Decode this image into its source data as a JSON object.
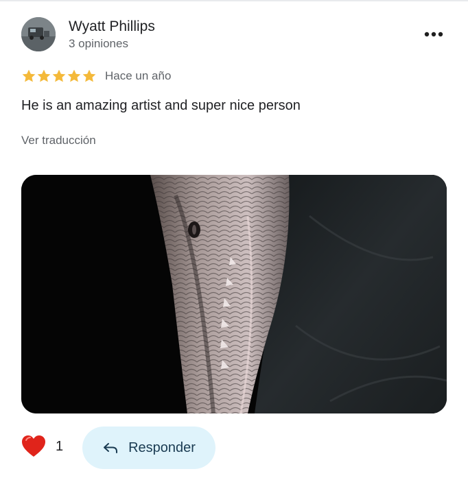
{
  "review": {
    "author": "Wyatt Phillips",
    "review_count": "3 opiniones",
    "rating": 5,
    "time": "Hace un año",
    "text": "He is an amazing artist and super nice person",
    "translate_label": "Ver traducción"
  },
  "actions": {
    "like_count": "1",
    "reply_label": "Responder"
  },
  "colors": {
    "star": "#f4b93a",
    "heart": "#e0241b",
    "reply_bg": "#dff3fb"
  },
  "icons": [
    "more-vert-icon",
    "star-icon",
    "heart-icon",
    "reply-arrow-icon"
  ]
}
